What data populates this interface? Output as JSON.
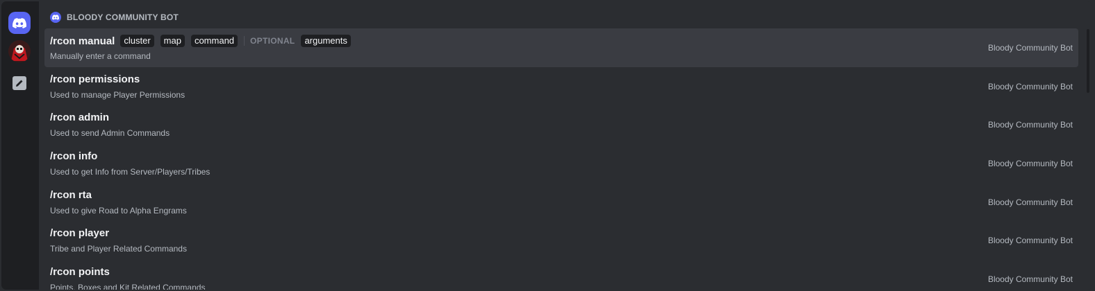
{
  "sidebar": {
    "items": [
      {
        "name": "Direct Messages",
        "icon": "discord-logo-icon"
      },
      {
        "name": "Bloody Community",
        "icon": "server-icon"
      },
      {
        "name": "Edit",
        "icon": "pencil-icon"
      }
    ]
  },
  "section": {
    "title": "BLOODY COMMUNITY BOT",
    "icon": "discord-logo-icon"
  },
  "commands": [
    {
      "name": "/rcon manual",
      "description": "Manually enter a command",
      "source": "Bloody Community Bot",
      "required_args": [
        "cluster",
        "map",
        "command"
      ],
      "optional_label": "OPTIONAL",
      "optional_args": [
        "arguments"
      ]
    },
    {
      "name": "/rcon permissions",
      "description": "Used to manage Player Permissions",
      "source": "Bloody Community Bot"
    },
    {
      "name": "/rcon admin",
      "description": "Used to send Admin Commands",
      "source": "Bloody Community Bot"
    },
    {
      "name": "/rcon info",
      "description": "Used to get Info from Server/Players/Tribes",
      "source": "Bloody Community Bot"
    },
    {
      "name": "/rcon rta",
      "description": "Used to give Road to Alpha Engrams",
      "source": "Bloody Community Bot"
    },
    {
      "name": "/rcon player",
      "description": "Tribe and Player Related Commands",
      "source": "Bloody Community Bot"
    },
    {
      "name": "/rcon points",
      "description": "Points, Boxes and Kit Related Commands",
      "source": "Bloody Community Bot"
    }
  ],
  "colors": {
    "background": "#2b2d31",
    "rail": "#1e1f22",
    "blurple": "#5865f2",
    "active_row": "#3a3c42"
  }
}
